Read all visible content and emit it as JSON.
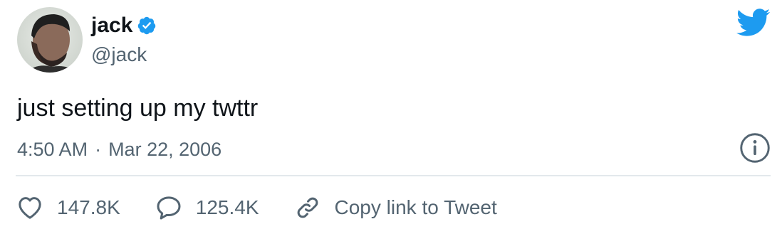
{
  "author": {
    "display_name": "jack",
    "handle": "@jack",
    "verified": true
  },
  "tweet": {
    "text": "just setting up my twttr",
    "time": "4:50 AM",
    "separator": "·",
    "date": "Mar 22, 2006"
  },
  "actions": {
    "likes_count": "147.8K",
    "replies_count": "125.4K",
    "copy_link_label": "Copy link to Tweet"
  },
  "icons": {
    "brand": "twitter-bird-icon",
    "verified": "verified-badge-icon",
    "info": "info-icon",
    "like": "heart-icon",
    "reply": "reply-bubble-icon",
    "link": "link-icon"
  },
  "colors": {
    "brand_blue": "#1d9bf0",
    "text_primary": "#0f1419",
    "text_secondary": "#536471",
    "divider": "#e3e8ec"
  }
}
